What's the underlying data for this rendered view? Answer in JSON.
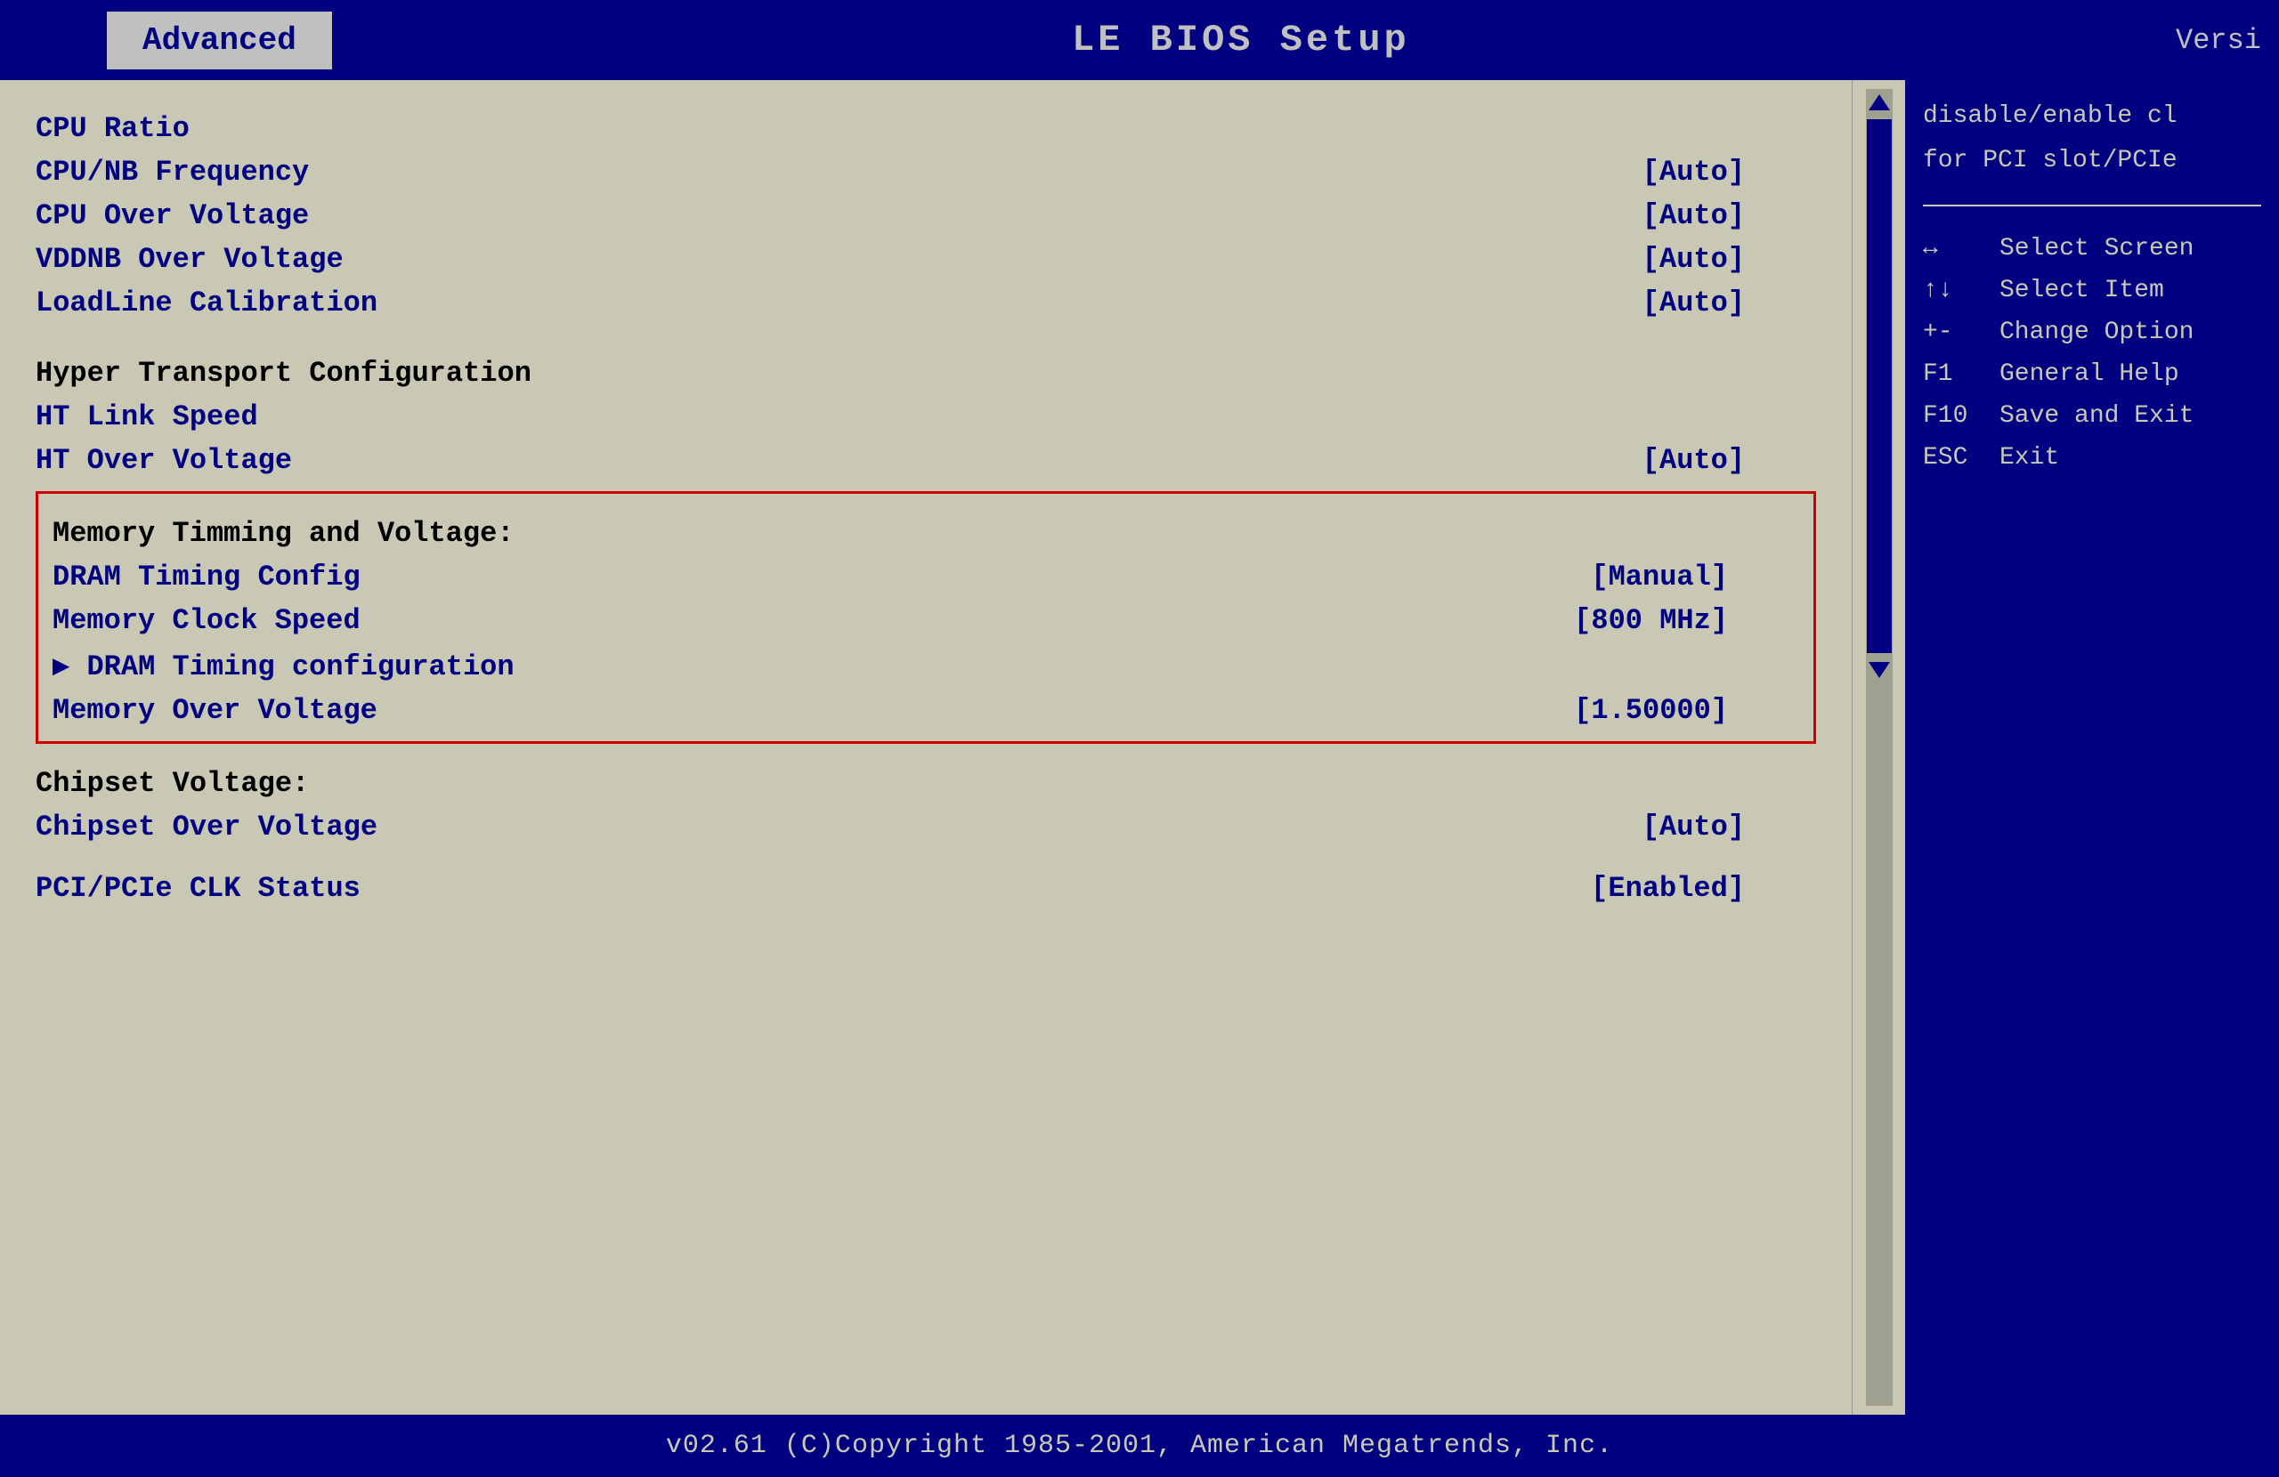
{
  "header": {
    "tab_label": "Advanced",
    "title": "LE BIOS  Setup",
    "version_label": "Versi"
  },
  "menu": {
    "items": [
      {
        "label": "CPU Ratio",
        "value": ""
      },
      {
        "label": "CPU/NB Frequency",
        "value": "[Auto]"
      },
      {
        "label": "CPU Over Voltage",
        "value": "[Auto]"
      },
      {
        "label": "VDDNB Over Voltage",
        "value": "[Auto]"
      },
      {
        "label": "LoadLine Calibration",
        "value": "[Auto]"
      }
    ],
    "ht_section_header": "Hyper Transport Configuration",
    "ht_items": [
      {
        "label": "HT Link Speed",
        "value": ""
      },
      {
        "label": "HT Over Voltage",
        "value": "[Auto]"
      }
    ],
    "memory_section": {
      "header": "Memory Timming and Voltage:",
      "items": [
        {
          "label": "DRAM Timing Config",
          "value": "[Manual]"
        },
        {
          "label": "Memory Clock Speed",
          "value": "[800 MHz]"
        },
        {
          "label": "▶  DRAM Timing configuration",
          "value": ""
        },
        {
          "label": "Memory Over Voltage",
          "value": "[1.50000]"
        }
      ]
    },
    "chipset_section": {
      "header": "Chipset Voltage:",
      "items": [
        {
          "label": "Chipset Over Voltage",
          "value": "[Auto]"
        }
      ]
    },
    "pci_item": {
      "label": "PCI/PCIe CLK Status",
      "value": "[Enabled]"
    }
  },
  "help_panel": {
    "description_line1": "disable/enable cl",
    "description_line2": "for PCI slot/PCIe",
    "keys": [
      {
        "key": "↔",
        "desc": "Select Screen"
      },
      {
        "key": "↑↓",
        "desc": "Select Item"
      },
      {
        "key": "+-",
        "desc": "Change Option"
      },
      {
        "key": "F1",
        "desc": "General Help"
      },
      {
        "key": "F10",
        "desc": "Save and Exit"
      },
      {
        "key": "ESC",
        "desc": "Exit"
      }
    ]
  },
  "footer": {
    "text": "v02.61  (C)Copyright 1985-2001, American Megatrends, Inc."
  }
}
